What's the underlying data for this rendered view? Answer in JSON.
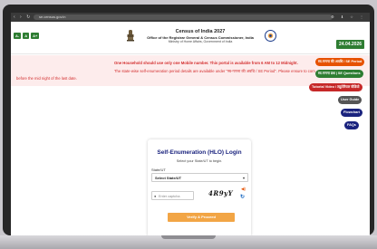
{
  "browser": {
    "nav_glyphs": "‹ › ↻",
    "url": "se.census.gov.in",
    "tool_glyphs": "⚙ ⬇ ☆ ⋮"
  },
  "header": {
    "accessibility": [
      "A-",
      "A",
      "A+"
    ],
    "title": "Census of India 2027",
    "subtitle": "Office of the Registrar General & Census Commissioner, India",
    "ministry": "Ministry of Home Affairs, Government of India",
    "date": "24.04.2026"
  },
  "notice": {
    "line1_left": "before the mid night of the last date.",
    "line1_right": "One Household should use only one Mobile number. This portal is available from 6 AM to 12 Midnight.",
    "line2": "The state-wise self-enumeration period details are available under \"स्व-गणना की अवधि / SE Period\". Please ensure to com"
  },
  "side_buttons": {
    "se_period": "स्व-गणना की अवधि / SE Period",
    "se_questions": "स्व-गणना प्रश्न | SE Questions",
    "tutorial_video": "Tutorial Video / ट्यूटोरियल वीडियो",
    "user_guide": "User Guide",
    "flowchart": "Flowchart",
    "faqs": "FAQs"
  },
  "login": {
    "title": "Self-Enumeration (HLO) Login",
    "subtitle": "Select your State/UT to begin.",
    "state_label": "State/UT",
    "state_value": "Select State/UT",
    "captcha_placeholder": "Enter captcha",
    "captcha_text": "4R9yY",
    "verify_label": "Verify & Proceed"
  },
  "colors": {
    "accent_green": "#2e7d32",
    "notice_red": "#d32f2f",
    "verify_orange": "#f2a545",
    "title_navy": "#1a237e"
  }
}
